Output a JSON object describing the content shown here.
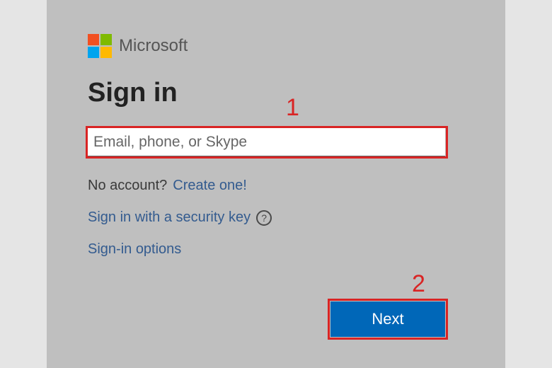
{
  "brand": {
    "name": "Microsoft",
    "colors": {
      "red": "#f25022",
      "green": "#7fba00",
      "blue": "#00a4ef",
      "yellow": "#ffb900"
    }
  },
  "signin": {
    "heading": "Sign in",
    "email_placeholder": "Email, phone, or Skype",
    "email_value": "",
    "no_account_text": "No account?",
    "create_one_link": "Create one!",
    "security_key_link": "Sign in with a security key",
    "help_icon_label": "?",
    "signin_options_link": "Sign-in options",
    "next_button": "Next"
  },
  "annotations": {
    "step1": "1",
    "step2": "2",
    "highlight_color": "#d92424"
  }
}
